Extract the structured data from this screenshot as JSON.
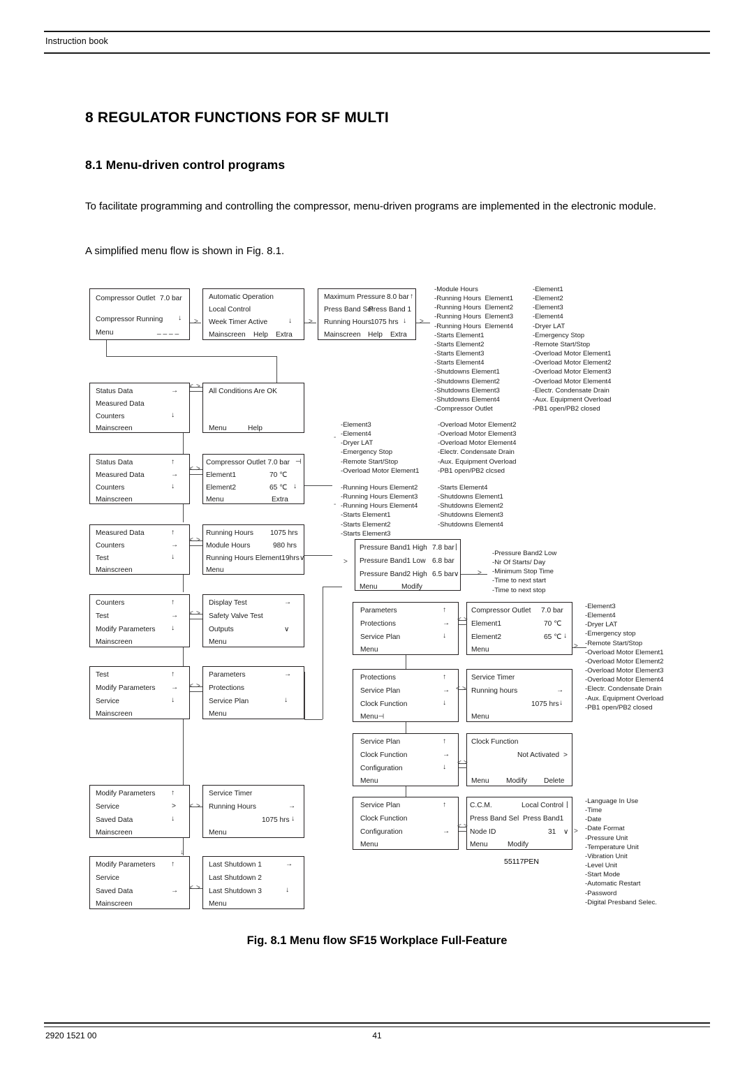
{
  "header": {
    "text": "Instruction book"
  },
  "headings": {
    "chapter": "8 REGULATOR FUNCTIONS FOR SF MULTI",
    "section": "8.1 Menu-driven control programs"
  },
  "paragraphs": {
    "p1": "To facilitate programming and controlling the compressor, menu-driven programs are implemented in the electronic module.",
    "p2": "A simplified menu flow is shown in Fig. 8.1."
  },
  "figure": {
    "caption": "Fig. 8.1 Menu flow SF15 Workplace Full-Feature",
    "drawing_code": "55117PEN",
    "screens": {
      "mainscreen": {
        "r1l": "Compressor Outlet",
        "r1v": "7.0 bar",
        "r2l": "Compressor Running",
        "r2a": "↓",
        "r3l": "Menu",
        "r3v": "_ _ _ _"
      },
      "auto_operation": {
        "r1": "Automatic  Operation",
        "r2": "Local Control",
        "r3": "Week Timer Active",
        "r3a": "↓",
        "r4a": "Mainscreen",
        "r4b": "Help",
        "r4c": "Extra"
      },
      "max_pressure": {
        "r1l": "Maximum Pressure",
        "r1v": "8.0 bar",
        "r1a": "↑",
        "r2l": "Press Band Sel",
        "r2v": "Press Band 1",
        "r3l": "Running Hours",
        "r3v": "1075 hrs",
        "r3a": "↓",
        "r4a": "Mainscreen",
        "r4b": "Help",
        "r4c": "Extra"
      },
      "status_menu": {
        "r1": "Status Data",
        "r1a": "→",
        "r2": "Measured Data",
        "r3": "Counters",
        "r3a": "↓",
        "r4": "Mainscreen"
      },
      "all_conditions": {
        "r1": "All Conditions Are OK",
        "r4a": "Menu",
        "r4b": "Help"
      },
      "measured_menu": {
        "r1": "Status Data",
        "r1a": "↑",
        "r2": "Measured Data",
        "r2a": "→",
        "r3": "Counters",
        "r3a": "↓",
        "r4": "Mainscreen"
      },
      "measured_values": {
        "r1l": "Compressor Outlet 7.0 bar",
        "r1a": "⊣",
        "r2l": "Element1",
        "r2v": "70 ℃",
        "r3l": "Element2",
        "r3v": "65 ℃",
        "r3a": "↓",
        "r4l": "Menu",
        "r4v": "Extra"
      },
      "counters_menu": {
        "r1": "Measured Data",
        "r1a": "↑",
        "r2": "Counters",
        "r2a": "→",
        "r3": "Test",
        "r3a": "↓",
        "r4": "Mainscreen"
      },
      "counters_values": {
        "r1l": "Running Hours",
        "r1v": "1075 hrs",
        "r2l": "Module Hours",
        "r2v": "980 hrs",
        "r3l": "Running Hours Element1",
        "r3v": "9hrs",
        "r3a": "∨",
        "r4l": "Menu"
      },
      "test_menu": {
        "r1": "Counters",
        "r1a": "↑",
        "r2": "Test",
        "r2a": "→",
        "r3": "Modify Parameters",
        "r3a": "↓",
        "r4": "Mainscreen"
      },
      "test_items": {
        "r1": "Display Test",
        "r1a": "→",
        "r2": "Safety Valve Test",
        "r3": "Outputs",
        "r3a": "∨",
        "r4": "Menu"
      },
      "modify_menu": {
        "r1": "Test",
        "r1a": "↑",
        "r2": "Modify Parameters",
        "r2a": "→",
        "r3": "Service",
        "r3a": "↓",
        "r4": "Mainscreen"
      },
      "params_menu": {
        "r1": "Parameters",
        "r1a": "→",
        "r2": "Protections",
        "r3": "Service Plan",
        "r3a": "↓",
        "r4": "Menu"
      },
      "pressure_bands": {
        "r1l": "Pressure Band1 High",
        "r1v": "7.8 bar",
        "r1a": "|",
        "r2l": "Pressure Band1 Low",
        "r2v": "6.8 bar",
        "r3l": "Pressure Band2 High",
        "r3v": "6.5 bar",
        "r3a": "∨",
        "r4l": "Menu",
        "r4v": "Modify"
      },
      "params_menu2": {
        "r1": "Parameters",
        "r1a": "↑",
        "r2": "Protections",
        "r2a": "→",
        "r3": "Service Plan",
        "r3a": "↓",
        "r4": "Menu"
      },
      "protections_values": {
        "r1l": "Compressor Outlet",
        "r1v": "7.0 bar",
        "r2l": "Element1",
        "r2v": "70 ℃",
        "r3l": "Element2",
        "r3v": "65 ℃",
        "r3a": "↓",
        "r4l": "Menu"
      },
      "serviceplan_menu": {
        "r1": "Protections",
        "r1a": "↑",
        "r2": "Service Plan",
        "r2a": "→",
        "r3": "Clock Function",
        "r3a": "↓",
        "r4": "Menu⊣"
      },
      "service_timer_a": {
        "r1": "Service Timer",
        "r2": "Running hours",
        "r2a": "→",
        "r3v": "1075 hrs",
        "r3a": "↓",
        "r4": "Menu"
      },
      "clock_menu": {
        "r1": "Service Plan",
        "r1a": "↑",
        "r2": "Clock Function",
        "r2a": "→",
        "r3": "Configuration",
        "r3a": "↓",
        "r4": "Menu"
      },
      "clock_values": {
        "r1": "Clock Function",
        "r2v": "Not Activated",
        "r2a": ">",
        "r4a": "Menu",
        "r4b": "Modify",
        "r4c": "Delete"
      },
      "config_menu": {
        "r1": "Service Plan",
        "r1a": "↑",
        "r2": "Clock Function",
        "r3": "Configuration",
        "r3a": "→",
        "r4": "Menu"
      },
      "config_values": {
        "r1l": "C.C.M.",
        "r1v": "Local Control",
        "r1a": "|",
        "r2l": "Press Band Sel",
        "r2v": "Press Band1",
        "r3l": "Node ID",
        "r3v": "31",
        "r3a": "∨",
        "r4l": "Menu",
        "r4v": "Modify"
      },
      "service_menu": {
        "r1": "Modify Parameters",
        "r1a": "↑",
        "r2": "Service",
        "r2a": ">",
        "r3": "Saved Data",
        "r3a": "↓",
        "r4": "Mainscreen"
      },
      "service_timer_b": {
        "r1": "Service Timer",
        "r2": "Running Hours",
        "r2a": "→",
        "r3v": "1075 hrs",
        "r3a": "↓",
        "r4": "Menu"
      },
      "saved_menu": {
        "r1": "Modify Parameters",
        "r1a": "↑",
        "r2": "Service",
        "r3": "Saved Data",
        "r3a": "→",
        "r4": "Mainscreen"
      },
      "shutdowns": {
        "r1": "Last Shutdown 1",
        "r1a": "→",
        "r2": "Last Shutdown 2",
        "r3": "Last Shutdown 3",
        "r3a": "↓",
        "r4": "Menu"
      }
    },
    "lists": {
      "counters_col1": "-Module Hours\n-Running Hours  Element1\n-Running Hours  Element2\n-Running Hours  Element3\n-Running Hours  Element4\n-Starts Element1\n-Starts Element2\n-Starts Element3\n-Starts Element4\n-Shutdowns Element1\n-Shutdowns Element2\n-Shutdowns Element3\n-Shutdowns Element4\n-Compressor Outlet",
      "counters_col2": "-Element1\n-Element2\n-Element3\n-Element4\n-Dryer LAT\n-Emergency Stop\n-Remote Start/Stop\n-Overload Motor Element1\n-Overload Motor Element2\n-Overload Motor Element3\n-Overload Motor Element4\n-Electr. Condensate Drain\n-Aux. Equipment Overload\n-PB1 open/PB2 closed",
      "measured_col1": "-Element3\n-Element4\n-Dryer LAT\n-Emergency Stop\n-Remote Start/Stop\n-Overload Motor Element1",
      "measured_col2": "-Overload Motor Element2\n-Overload Motor Element3\n-Overload Motor Element4\n-Electr. Condensate Drain\n-Aux. Equipment Overload\n-PB1 open/PB2 clcsed",
      "counters2_col1": "-Running Hours Element2\n-Running Hours Element3\n-Running Hours Element4\n-Starts Element1\n-Starts Element2\n-Starts Element3",
      "counters2_col2": "-Starts Element4\n-Shutdowns Element1\n-Shutdowns Element2\n-Shutdowns Element3\n-Shutdowns Element4",
      "pressure_more": "-Pressure Band2 Low\n-Nr Of Starts/ Day\n-Minimum Stop Time\n-Time to next start\n-Time to next stop",
      "protections_more": "-Element3\n-Element4\n-Dryer LAT\n-Emergency stop\n-Remote Start/Stop\n-Overload Motor Element1\n-Overload Motor Element2\n-Overload Motor Element3\n-Overload Motor Element4\n-Electr. Condensate Drain\n-Aux. Equipment Overload\n-PB1 open/PB2 closed",
      "config_more": "-Language In Use\n-Time\n-Date\n-Date Format\n-Pressure Unit\n-Temperature Unit\n-Vibration Unit\n-Level Unit\n-Start Mode\n-Automatic Restart\n-Password\n-Digital Presband Selec."
    }
  },
  "footer": {
    "doc_number": "2920 1521 00",
    "page_number": "41"
  }
}
